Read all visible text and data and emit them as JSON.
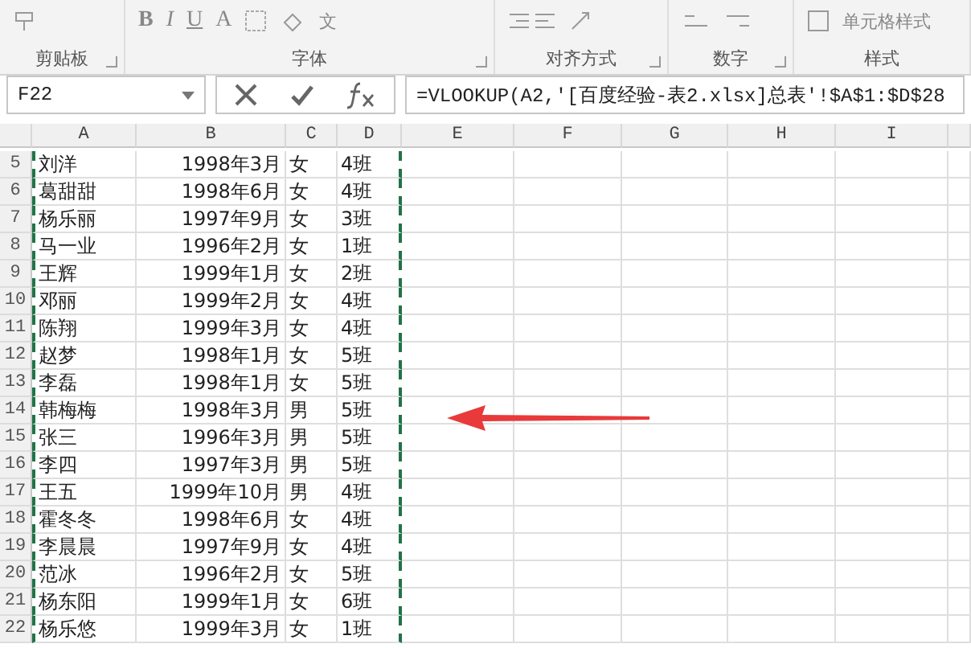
{
  "ribbon": {
    "font_buttons": [
      "B",
      "I",
      "U",
      "A"
    ],
    "phonetic": "文",
    "cell_styles": "单元格样式",
    "groups": [
      {
        "label": "剪贴板",
        "launcher": true
      },
      {
        "label": "字体",
        "launcher": true
      },
      {
        "label": "对齐方式",
        "launcher": true
      },
      {
        "label": "数字",
        "launcher": true
      },
      {
        "label": "样式",
        "launcher": false
      }
    ]
  },
  "formula_bar": {
    "name_box": "F22",
    "formula": "=VLOOKUP(A2,'[百度经验-表2.xlsx]总表'!$A$1:$D$28"
  },
  "sheet": {
    "columns": [
      "A",
      "B",
      "C",
      "D",
      "E",
      "F",
      "G",
      "H",
      "I"
    ],
    "rows": [
      {
        "row": "5",
        "cells": [
          "刘洋",
          "1998年3月",
          "女",
          "4班"
        ]
      },
      {
        "row": "6",
        "cells": [
          "葛甜甜",
          "1998年6月",
          "女",
          "4班"
        ]
      },
      {
        "row": "7",
        "cells": [
          "杨乐丽",
          "1997年9月",
          "女",
          "3班"
        ]
      },
      {
        "row": "8",
        "cells": [
          "马一业",
          "1996年2月",
          "女",
          "1班"
        ]
      },
      {
        "row": "9",
        "cells": [
          "王辉",
          "1999年1月",
          "女",
          "2班"
        ]
      },
      {
        "row": "10",
        "cells": [
          "邓丽",
          "1999年2月",
          "女",
          "4班"
        ]
      },
      {
        "row": "11",
        "cells": [
          "陈翔",
          "1999年3月",
          "女",
          "4班"
        ]
      },
      {
        "row": "12",
        "cells": [
          "赵梦",
          "1998年1月",
          "女",
          "5班"
        ]
      },
      {
        "row": "13",
        "cells": [
          "李磊",
          "1998年1月",
          "女",
          "5班"
        ]
      },
      {
        "row": "14",
        "cells": [
          "韩梅梅",
          "1998年3月",
          "男",
          "5班"
        ]
      },
      {
        "row": "15",
        "cells": [
          "张三",
          "1996年3月",
          "男",
          "5班"
        ]
      },
      {
        "row": "16",
        "cells": [
          "李四",
          "1997年3月",
          "男",
          "5班"
        ]
      },
      {
        "row": "17",
        "cells": [
          "王五",
          "1999年10月",
          "男",
          "4班"
        ]
      },
      {
        "row": "18",
        "cells": [
          "霍冬冬",
          "1998年6月",
          "女",
          "4班"
        ]
      },
      {
        "row": "19",
        "cells": [
          "李晨晨",
          "1997年9月",
          "女",
          "4班"
        ]
      },
      {
        "row": "20",
        "cells": [
          "范冰",
          "1996年2月",
          "女",
          "5班"
        ]
      },
      {
        "row": "21",
        "cells": [
          "杨东阳",
          "1999年1月",
          "女",
          "6班"
        ]
      },
      {
        "row": "22",
        "cells": [
          "杨乐悠",
          "1999年3月",
          "女",
          "1班"
        ]
      }
    ]
  }
}
